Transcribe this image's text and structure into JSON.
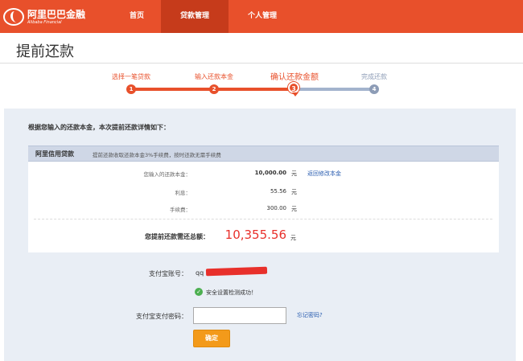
{
  "header": {
    "logo_text": "阿里巴巴金融",
    "logo_subtext": "Alibaba Financial",
    "nav": [
      {
        "label": "首页"
      },
      {
        "label": "贷款管理"
      },
      {
        "label": "个人管理"
      }
    ],
    "active_nav": "贷款管理"
  },
  "page": {
    "title": "提前还款"
  },
  "steps": [
    {
      "number": "1",
      "label": "选择一笔贷款",
      "status": "done"
    },
    {
      "number": "2",
      "label": "输入还款本金",
      "status": "done"
    },
    {
      "number": "3",
      "label": "确认还款金额",
      "status": "current"
    },
    {
      "number": "4",
      "label": "完成还款",
      "status": "todo"
    }
  ],
  "summary": {
    "intro": "根据您输入的还款本金，本次提前还款详情如下：",
    "card_title": "阿里信用贷款",
    "card_note": "提前还款收取还款本金3%手续费，按时还款无需手续费",
    "rows": [
      {
        "label": "您输入的还款本金：",
        "value": "10,000.00",
        "unit": "元"
      },
      {
        "label": "利息：",
        "value": "55.56",
        "unit": "元"
      },
      {
        "label": "手续费：",
        "value": "300.00",
        "unit": "元"
      }
    ],
    "edit_link": "返回修改本金",
    "total_label": "您提前还款需还总额：",
    "total_value": "10,355.56",
    "total_unit": "元"
  },
  "form": {
    "account_label": "支付宝账号：",
    "account_value": "qq",
    "security_ok_text": "安全设置检测成功！",
    "password_label": "支付宝支付密码：",
    "password_value": "",
    "forgot_link": "忘记密码?",
    "confirm_button": "确定"
  },
  "colors": {
    "brand": "#e8502b",
    "nav_active": "#c63b1b",
    "total_amount": "#e8302b",
    "confirm_button": "#f39a1a",
    "step_todo": "#8d9cb6",
    "link": "#2a5db0"
  },
  "icons": {
    "logo": "alibaba-logo-icon",
    "security_ok": "check-circle-icon"
  }
}
